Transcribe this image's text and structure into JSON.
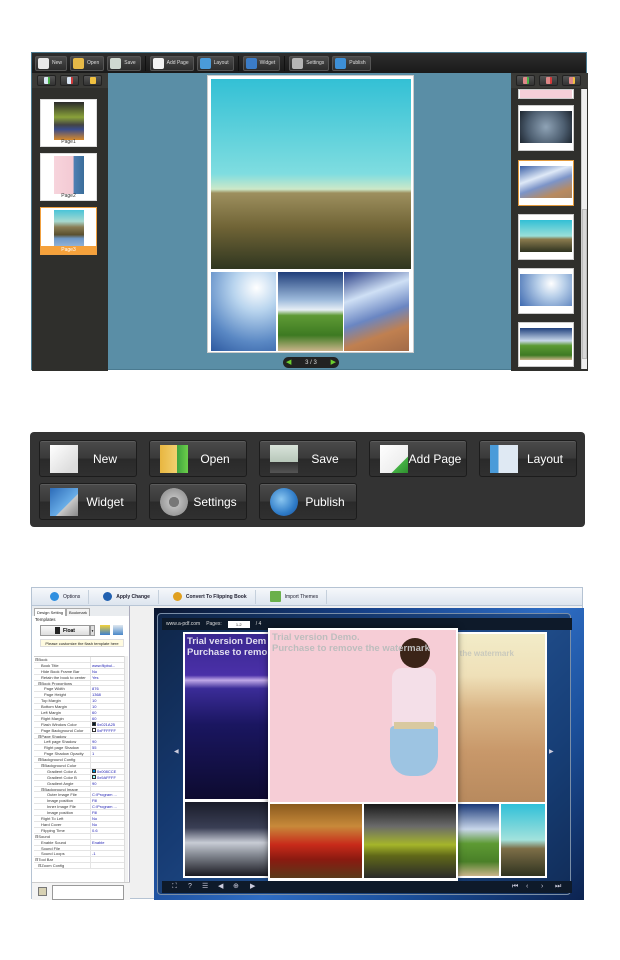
{
  "editor": {
    "toolbar": [
      {
        "id": "new",
        "label": "New",
        "icon": "new-file-icon",
        "color": "#e8e8e8"
      },
      {
        "id": "open",
        "label": "Open",
        "icon": "folder-open-icon",
        "color": "#e6b947"
      },
      {
        "id": "save",
        "label": "Save",
        "icon": "floppy-save-icon",
        "color": "#cfd8d0"
      },
      {
        "id": "add-page",
        "label": "Add Page",
        "icon": "add-page-icon",
        "color": "#f2f2f2"
      },
      {
        "id": "layout",
        "label": "Layout",
        "icon": "layout-icon",
        "color": "#4a9bd9"
      },
      {
        "id": "widget",
        "label": "Widget",
        "icon": "widget-icon",
        "color": "#3b7cc7"
      },
      {
        "id": "settings",
        "label": "Settings",
        "icon": "gear-icon",
        "color": "#b5b5b5"
      },
      {
        "id": "publish",
        "label": "Publish",
        "icon": "globe-publish-icon",
        "color": "#3d8fd6"
      }
    ],
    "left_tools": [
      "add-page-icon",
      "delete-page-icon",
      "page-properties-icon"
    ],
    "pages": [
      {
        "label": "Page1",
        "selected": false
      },
      {
        "label": "Page2",
        "selected": false
      },
      {
        "label": "Page3",
        "selected": true
      }
    ],
    "pager": {
      "current": "3",
      "total": "3",
      "text": "3 / 3"
    },
    "right_tools": [
      "add-image-icon",
      "remove-image-icon",
      "image-edit-icon"
    ],
    "image_library_selected_index": 2
  },
  "toolbar_zoom": {
    "buttons": [
      {
        "label": "New",
        "icon": "new-file-icon"
      },
      {
        "label": "Open",
        "icon": "folder-open-icon"
      },
      {
        "label": "Save",
        "icon": "floppy-save-icon"
      },
      {
        "label": "Add Page",
        "icon": "add-page-icon"
      },
      {
        "label": "Layout",
        "icon": "layout-icon"
      },
      {
        "label": "Widget",
        "icon": "widget-icon"
      },
      {
        "label": "Settings",
        "icon": "gear-icon"
      },
      {
        "label": "Publish",
        "icon": "globe-publish-icon"
      }
    ]
  },
  "flipbook": {
    "menu": [
      {
        "label": "Options",
        "icon": "options-icon",
        "bold": false
      },
      {
        "label": "Apply Change",
        "icon": "apply-change-icon",
        "bold": true
      },
      {
        "label": "Convert To Flipping Book",
        "icon": "convert-icon",
        "bold": true
      },
      {
        "label": "Import Themes",
        "icon": "import-themes-icon",
        "bold": false
      }
    ],
    "tabs": [
      {
        "label": "Design Setting",
        "active": true
      },
      {
        "label": "Bookmark",
        "active": false
      }
    ],
    "templates_label": "Templates",
    "template_name": "Float",
    "template_hint": "Please customize the flash template here",
    "properties": [
      {
        "k": "⊟Book",
        "v": "",
        "indent": 0
      },
      {
        "k": "Book Title",
        "v": "www.flipbul...",
        "indent": 2
      },
      {
        "k": "Hide Book Frame Bar",
        "v": "No",
        "indent": 2
      },
      {
        "k": "Retain the book to center",
        "v": "Yes",
        "indent": 2
      },
      {
        "k": "⊟Book Proportions",
        "v": "",
        "indent": 1
      },
      {
        "k": "Page Width",
        "v": "876",
        "indent": 3
      },
      {
        "k": "Page Height",
        "v": "1368",
        "indent": 3
      },
      {
        "k": "Top Margin",
        "v": "10",
        "indent": 2
      },
      {
        "k": "Bottom Margin",
        "v": "10",
        "indent": 2
      },
      {
        "k": "Left Margin",
        "v": "60",
        "indent": 2
      },
      {
        "k": "Right Margin",
        "v": "60",
        "indent": 2
      },
      {
        "k": "Flash Window Color",
        "v": "0x021A25",
        "swatch": "#021a25",
        "indent": 2
      },
      {
        "k": "Page Background Color",
        "v": "0xFFFFFF",
        "swatch": "#ffffff",
        "indent": 2
      },
      {
        "k": "⊟Page Shadow",
        "v": "",
        "indent": 1
      },
      {
        "k": "Left page Shadow",
        "v": "90",
        "indent": 3
      },
      {
        "k": "Right page Shadow",
        "v": "55",
        "indent": 3
      },
      {
        "k": "Page Shadow Opacity",
        "v": "1",
        "indent": 3
      },
      {
        "k": "⊟Background Config",
        "v": "",
        "indent": 1
      },
      {
        "k": "⊟Background Color",
        "v": "",
        "indent": 2
      },
      {
        "k": "Gradient Color A",
        "v": "0x008CCE",
        "swatch": "#008cce",
        "indent": 4
      },
      {
        "k": "Gradient Color B",
        "v": "0x9AFFFF",
        "swatch": "#9affff",
        "indent": 4
      },
      {
        "k": "Gradient Angle",
        "v": "90",
        "indent": 4
      },
      {
        "k": "⊟Background Image",
        "v": "",
        "indent": 2
      },
      {
        "k": "Outer Image File",
        "v": "C:\\Program ...",
        "indent": 4
      },
      {
        "k": "Image position",
        "v": "Fill",
        "indent": 4
      },
      {
        "k": "Inner Image File",
        "v": "C:\\Program ...",
        "indent": 4
      },
      {
        "k": "Image position",
        "v": "Fill",
        "indent": 4
      },
      {
        "k": "Right To Left",
        "v": "No",
        "indent": 2
      },
      {
        "k": "Hard Cover",
        "v": "No",
        "indent": 2
      },
      {
        "k": "Flipping Time",
        "v": "0.6",
        "indent": 2
      },
      {
        "k": "⊟Sound",
        "v": "",
        "indent": 0
      },
      {
        "k": "Enable Sound",
        "v": "Enable",
        "indent": 2
      },
      {
        "k": "Sound File",
        "v": "",
        "indent": 2
      },
      {
        "k": "Sound Loops",
        "v": "-1",
        "indent": 2
      },
      {
        "k": "⊟Tool Bar",
        "v": "",
        "indent": 0
      },
      {
        "k": "⊟Zoom Config",
        "v": "",
        "indent": 1
      }
    ],
    "viewer": {
      "site": "www.a-pdf.com",
      "pages_label": "Pages:",
      "pages_value": "1-2",
      "pages_total": "/ 4",
      "watermark_line1": "Trial version Demo.",
      "watermark_line2": "Purchase to remove the watermark",
      "left_watermark_line1": "Trial version Dem",
      "left_watermark_line2": "Purchase to remo",
      "right_watermark": "e the watermark",
      "bottom_left_controls": [
        "fullscreen-icon",
        "help-icon",
        "thumbnails-icon",
        "sound-icon",
        "zoom-icon",
        "autoplay-icon"
      ],
      "bottom_right_controls": [
        "first-page-icon",
        "prev-page-icon",
        "next-page-icon",
        "last-page-icon"
      ]
    }
  }
}
